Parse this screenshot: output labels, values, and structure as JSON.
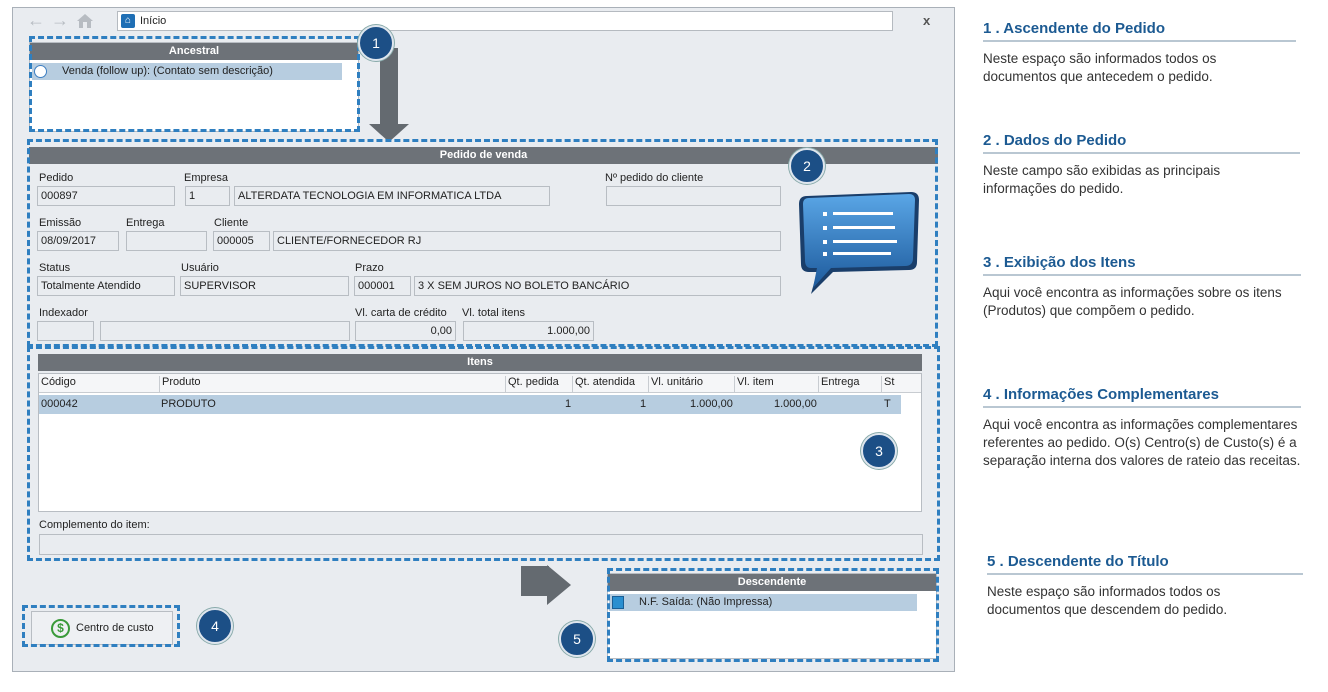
{
  "window": {
    "address": "Início",
    "close": "x",
    "nav": {
      "back": "←",
      "forward": "→"
    }
  },
  "ancestral": {
    "title": "Ancestral",
    "item": "Venda (follow up): (Contato sem descrição)"
  },
  "pedido": {
    "title": "Pedido de venda",
    "labels": {
      "pedido": "Pedido",
      "empresa": "Empresa",
      "num_cliente": "Nº pedido do cliente",
      "emissao": "Emissão",
      "entrega": "Entrega",
      "cliente": "Cliente",
      "status": "Status",
      "usuario": "Usuário",
      "prazo": "Prazo",
      "indexador": "Indexador",
      "vl_carta": "Vl. carta de crédito",
      "vl_total": "Vl. total itens"
    },
    "values": {
      "pedido": "000897",
      "empresa_cod": "1",
      "empresa_nome": "ALTERDATA TECNOLOGIA EM INFORMATICA LTDA",
      "num_cliente": "",
      "emissao": "08/09/2017",
      "entrega": "",
      "cliente_cod": "000005",
      "cliente_nome": "CLIENTE/FORNECEDOR RJ",
      "status": "Totalmente Atendido",
      "usuario": "SUPERVISOR",
      "prazo_cod": "000001",
      "prazo_desc": "3 X SEM JUROS NO BOLETO BANCÁRIO",
      "indexador_cod": "",
      "indexador_desc": "",
      "vl_carta": "0,00",
      "vl_total": "1.000,00"
    }
  },
  "itens": {
    "title": "Itens",
    "columns": [
      "Código",
      "Produto",
      "Qt. pedida",
      "Qt. atendida",
      "Vl. unitário",
      "Vl. item",
      "Entrega",
      "St"
    ],
    "rows": [
      {
        "codigo": "000042",
        "produto": "PRODUTO",
        "qt_pedida": "1",
        "qt_atendida": "1",
        "vl_unitario": "1.000,00",
        "vl_item": "1.000,00",
        "entrega": "",
        "st": "T"
      }
    ],
    "complemento_label": "Complemento do item:",
    "complemento_value": ""
  },
  "descendente": {
    "title": "Descendente",
    "item": "N.F. Saída: (Não Impressa)"
  },
  "centro_custo": {
    "label": "Centro de custo",
    "icon": "dollar-icon"
  },
  "markers": [
    "1",
    "2",
    "3",
    "4",
    "5"
  ],
  "help": [
    {
      "title": "1 . Ascendente do Pedido",
      "text": "Neste espaço são informados todos os documentos que antecedem o pedido."
    },
    {
      "title": "2 . Dados do Pedido",
      "text": "Neste campo são exibidas as principais informações do pedido."
    },
    {
      "title": "3 . Exibição dos Itens",
      "text": "Aqui você encontra as informações sobre os itens (Produtos) que compõem o pedido."
    },
    {
      "title": "4 . Informações Complementares",
      "text": "Aqui você encontra as informações complementares referentes ao pedido. O(s) Centro(s) de Custo(s) é a separação interna dos valores de rateio das receitas."
    },
    {
      "title": "5 . Descendente do Título",
      "text": "Neste espaço são informados todos os documentos que descendem do pedido."
    }
  ],
  "colors": {
    "accent": "#1c5a92",
    "dashed": "#2f7fc0",
    "header": "#6d7278",
    "selection": "#b7cde0"
  }
}
